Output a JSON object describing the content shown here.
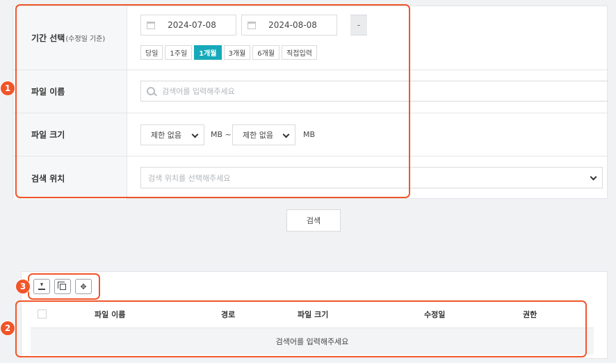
{
  "form": {
    "period_label": "기간 선택",
    "period_sub": "(수정일 기준)",
    "date_from": "2024-07-08",
    "date_sep": "-",
    "date_to": "2024-08-08",
    "periods": [
      {
        "label": "당일",
        "active": false
      },
      {
        "label": "1주일",
        "active": false
      },
      {
        "label": "1개월",
        "active": true
      },
      {
        "label": "3개월",
        "active": false
      },
      {
        "label": "6개월",
        "active": false
      },
      {
        "label": "직접입력",
        "active": false
      }
    ],
    "name_label": "파일 이름",
    "name_placeholder": "검색어를 입력해주세요",
    "size_label": "파일 크기",
    "size_min": "제한 없음",
    "size_unit_sep": "MB ~",
    "size_max": "제한 없음",
    "size_unit": "MB",
    "location_label": "검색 위치",
    "location_placeholder": "검색 위치를 선택해주세요"
  },
  "search_button": "검색",
  "table": {
    "columns": [
      "파일 이름",
      "경로",
      "파일 크기",
      "수정일",
      "권한"
    ],
    "empty_text": "검색어를 입력해주세요"
  },
  "annotations": [
    "1",
    "2",
    "3"
  ],
  "colors": {
    "accent": "#16a9b9",
    "highlight": "#f0552a"
  },
  "icons": [
    "calendar-icon",
    "search-icon",
    "chevron-down-icon",
    "download-icon",
    "copy-icon",
    "move-icon"
  ]
}
